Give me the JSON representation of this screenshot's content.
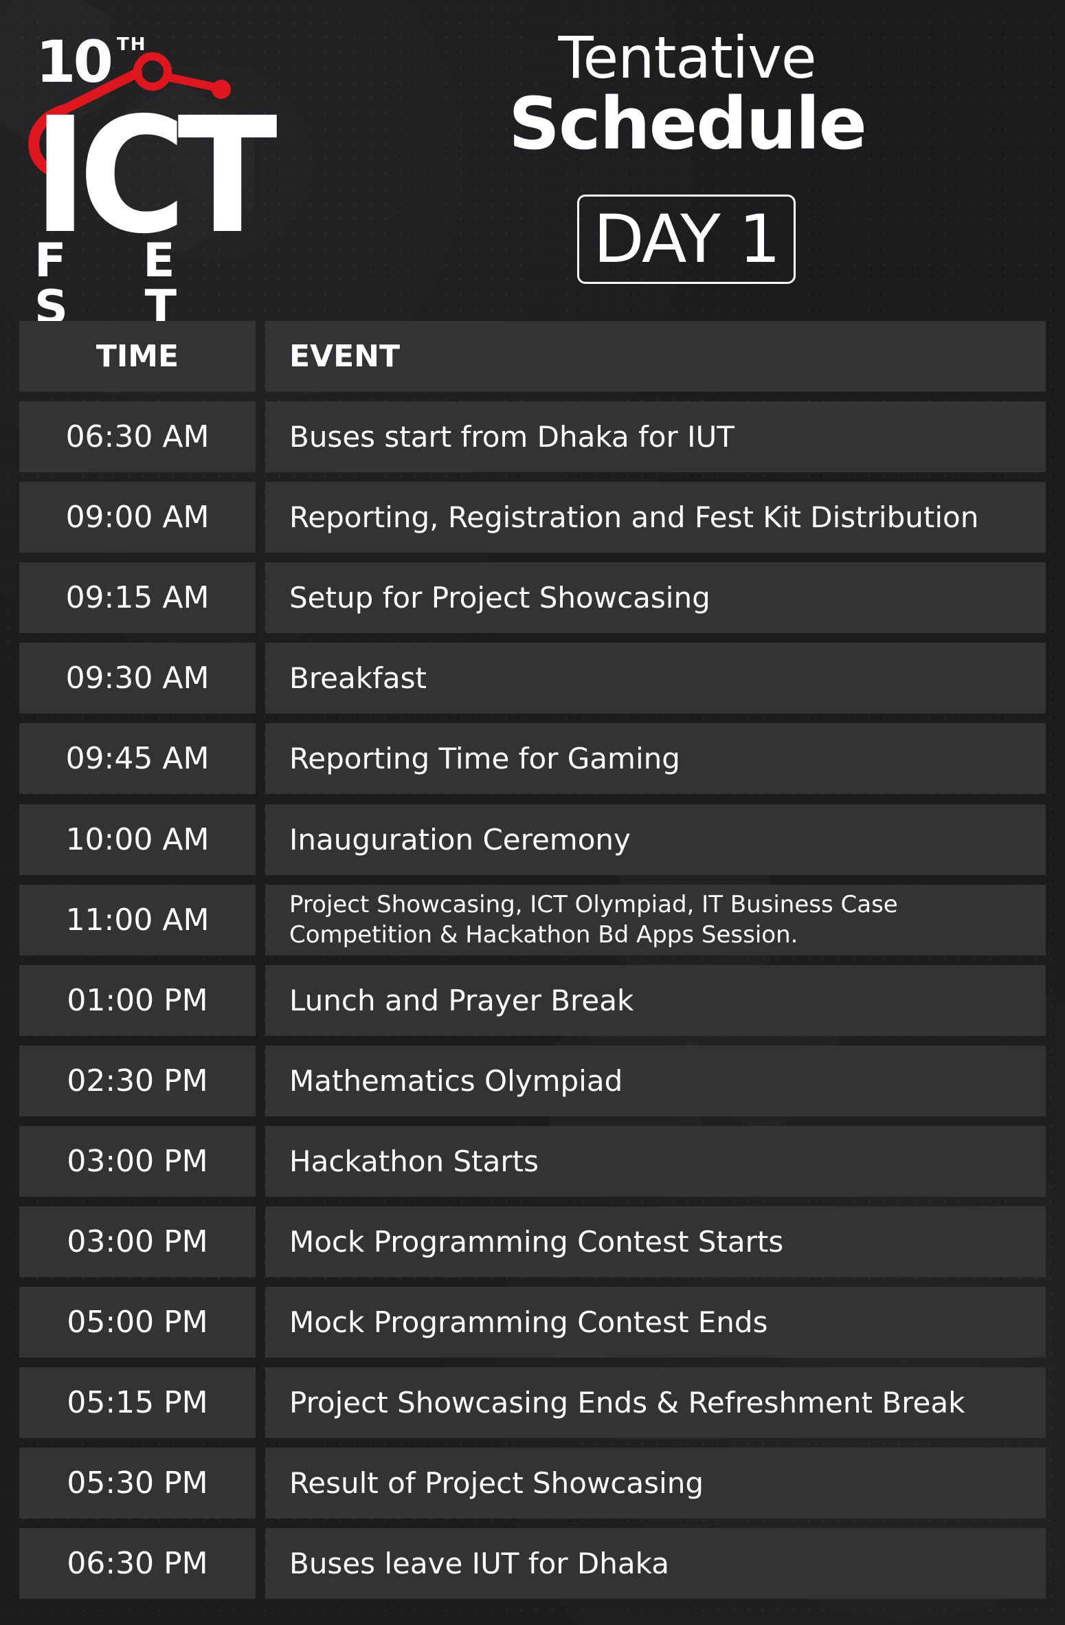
{
  "logo": {
    "number": "10",
    "suffix": "TH",
    "word": "ICT",
    "sub": "F E S T",
    "accent_color": "#e0161f"
  },
  "title": {
    "line1": "Tentative",
    "line2": "Schedule",
    "day": "DAY 1"
  },
  "table": {
    "headers": {
      "time": "TIME",
      "event": "EVENT"
    },
    "rows": [
      {
        "time": "06:30 AM",
        "event": "Buses start from Dhaka for IUT"
      },
      {
        "time": "09:00 AM",
        "event": "Reporting, Registration and Fest Kit Distribution"
      },
      {
        "time": "09:15 AM",
        "event": "Setup for Project Showcasing"
      },
      {
        "time": "09:30 AM",
        "event": "Breakfast"
      },
      {
        "time": "09:45 AM",
        "event": "Reporting Time for Gaming"
      },
      {
        "time": "10:00 AM",
        "event": "Inauguration Ceremony"
      },
      {
        "time": "11:00 AM",
        "event": "Project Showcasing, ICT Olympiad, IT Business Case Competition & Hackathon Bd Apps Session."
      },
      {
        "time": "01:00 PM",
        "event": "Lunch and Prayer Break"
      },
      {
        "time": "02:30 PM",
        "event": "Mathematics Olympiad"
      },
      {
        "time": "03:00 PM",
        "event": "Hackathon Starts"
      },
      {
        "time": "03:00 PM",
        "event": "Mock Programming Contest Starts"
      },
      {
        "time": "05:00 PM",
        "event": "Mock Programming Contest Ends"
      },
      {
        "time": "05:15 PM",
        "event": "Project Showcasing Ends & Refreshment Break"
      },
      {
        "time": "05:30 PM",
        "event": "Result of Project Showcasing"
      },
      {
        "time": "06:30 PM",
        "event": "Buses leave IUT for Dhaka"
      }
    ]
  }
}
